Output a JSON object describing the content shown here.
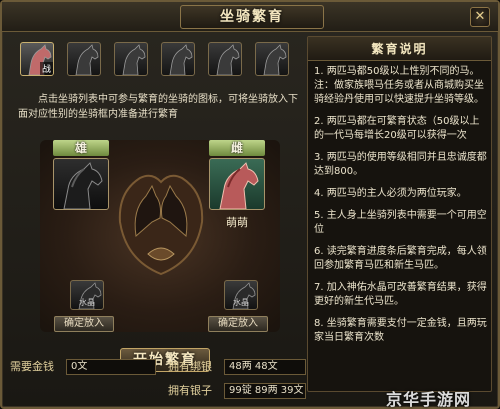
{
  "window": {
    "title": "坐骑繁育",
    "close_glyph": "✕"
  },
  "mount_list": {
    "slots": [
      {
        "name": "mount-1",
        "badge": "战",
        "active": true,
        "color": "#c06a6a"
      },
      {
        "name": "mount-2",
        "badge": "",
        "active": false,
        "color": "#3a3a3a"
      },
      {
        "name": "mount-3",
        "badge": "",
        "active": false,
        "color": "#3a3a3a"
      },
      {
        "name": "mount-4",
        "badge": "",
        "active": false,
        "color": "#3a3a3a"
      },
      {
        "name": "mount-5",
        "badge": "",
        "active": false,
        "color": "#3a3a3a"
      },
      {
        "name": "mount-6",
        "badge": "",
        "active": false,
        "color": "#3a3a3a"
      }
    ]
  },
  "instructions": "点击坐骑列表中可参与繁育的坐骑的图标，可将坐骑放入下面对应性别的坐骑框内准备进行繁育",
  "breeding": {
    "male_label": "雄",
    "female_label": "雌",
    "female_name": "萌萌",
    "left_small_label": "水晶",
    "right_small_label": "水晶",
    "confirm_label": "确定放入",
    "start_label": "开始繁育"
  },
  "money": {
    "required_label": "需要金钱",
    "required_value": "0文",
    "bound_silver_label": "拥有绑银",
    "bound_silver_value": "48两 48文",
    "silver_label": "拥有银子",
    "silver_value": "99锭 89两 39文"
  },
  "rules": {
    "title": "繁育说明",
    "items": [
      "1. 两匹马都50级以上性别不同的马。注：做家族喂马任务或者从商城购买坐骑经验丹使用可以快速提升坐骑等级。",
      "2. 两匹马都在可繁育状态（50级以上的一代马每增长20级可以获得一次",
      "3. 两匹马的使用等级相同并且忠诚度都达到800。",
      "4. 两匹马的主人必须为两位玩家。",
      "5. 主人身上坐骑列表中需要一个可用空位",
      "6. 读完繁育进度条后繁育完成，每人领回参加繁育马匹和新生马匹。",
      "7. 加入神佑水晶可改善繁育结果，获得更好的新生代马匹。",
      "8. 坐骑繁育需要支付一定金钱，且两玩家当日繁育次数"
    ]
  },
  "watermark": "京华手游网"
}
